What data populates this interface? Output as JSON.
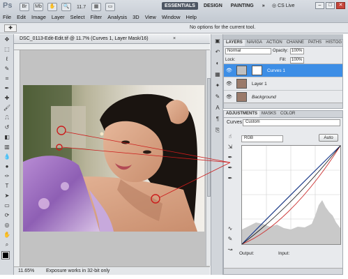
{
  "app": {
    "logo": "Ps",
    "zoom_field": "11.7",
    "workspaces": [
      "ESSENTIALS",
      "DESIGN",
      "PAINTING"
    ],
    "workspace_more": "»",
    "cs_live": "CS Live",
    "window_controls": [
      "–",
      "□",
      "✕"
    ]
  },
  "menu": [
    "File",
    "Edit",
    "Image",
    "Layer",
    "Select",
    "Filter",
    "Analysis",
    "3D",
    "View",
    "Window",
    "Help"
  ],
  "options_bar": {
    "tool_icon": "✚",
    "message": "No options for the current tool."
  },
  "document": {
    "tab_title": "DSC_0113-Edit-Edit.tif @ 11.7% (Curves 1, Layer Mask/16)",
    "tab_close": "×",
    "status_zoom": "11.65%",
    "status_message": "Exposure works in 32-bit only"
  },
  "layers_panel": {
    "tabs": [
      "LAYERS",
      "NAVIGA",
      "ACTION",
      "CHANNE",
      "PATHS",
      "HISTOG"
    ],
    "blend_mode": "Normal",
    "opacity_label": "Opacity:",
    "opacity_value": "100%",
    "lock_label": "Lock:",
    "fill_label": "Fill:",
    "fill_value": "100%",
    "layers": [
      {
        "name": "Curves 1",
        "selected": true
      },
      {
        "name": "Layer 1",
        "selected": false
      },
      {
        "name": "Background",
        "selected": false
      }
    ]
  },
  "adjustments_panel": {
    "tabs": [
      "ADJUSTMENTS",
      "MASKS",
      "COLOR"
    ],
    "type_label": "Curves",
    "preset": "Custom",
    "channel": "RGB",
    "auto_label": "Auto",
    "output_label": "Output:",
    "input_label": "Input:"
  },
  "colors": {
    "selected_layer": "#3d8ee6",
    "annotation_red": "#cc1b1b",
    "curve_blue": "#1a3b8f",
    "curve_red": "#c33"
  }
}
